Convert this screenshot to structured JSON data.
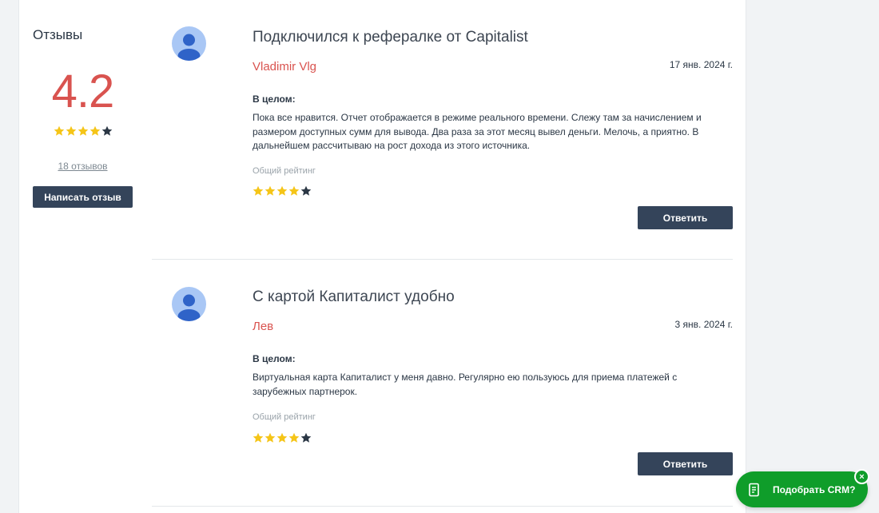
{
  "summary": {
    "title": "Отзывы",
    "rating": "4.2",
    "stars": {
      "filled": 4,
      "total": 5
    },
    "reviews_link": "18 отзывов",
    "write_button": "Написать отзыв"
  },
  "reviews": [
    {
      "title": "Подключился к рефералке от Capitalist",
      "author": "Vladimir Vlg",
      "date": "17 янв. 2024 г.",
      "section_label": "В целом:",
      "text": "Пока все нравится. Отчет отображается в режиме реального времени. Слежу там за начислением и размером доступных сумм для вывода. Два раза за этот месяц вывел деньги. Мелочь, а приятно. В дальнейшем рассчитываю на рост дохода из этого источника.",
      "overall_label": "Общий рейтинг",
      "stars": {
        "filled": 4,
        "total": 5
      },
      "reply_button": "Ответить"
    },
    {
      "title": "С картой Капиталист удобно",
      "author": "Лев",
      "date": "3 янв. 2024 г.",
      "section_label": "В целом:",
      "text": "Виртуальная карта Капиталист у меня давно. Регулярно ею пользуюсь для приема платежей с зарубежных партнерок.",
      "overall_label": "Общий рейтинг",
      "stars": {
        "filled": 4,
        "total": 5
      },
      "reply_button": "Ответить"
    }
  ],
  "crm_widget": {
    "label": "Подобрать CRM?",
    "icon": "document-icon",
    "close_symbol": "×"
  },
  "colors": {
    "accent_red": "#d9534f",
    "button_dark": "#34445a",
    "star_gold": "#f5c518",
    "star_empty": "#2b3745",
    "widget_green": "#0f9d2a"
  }
}
